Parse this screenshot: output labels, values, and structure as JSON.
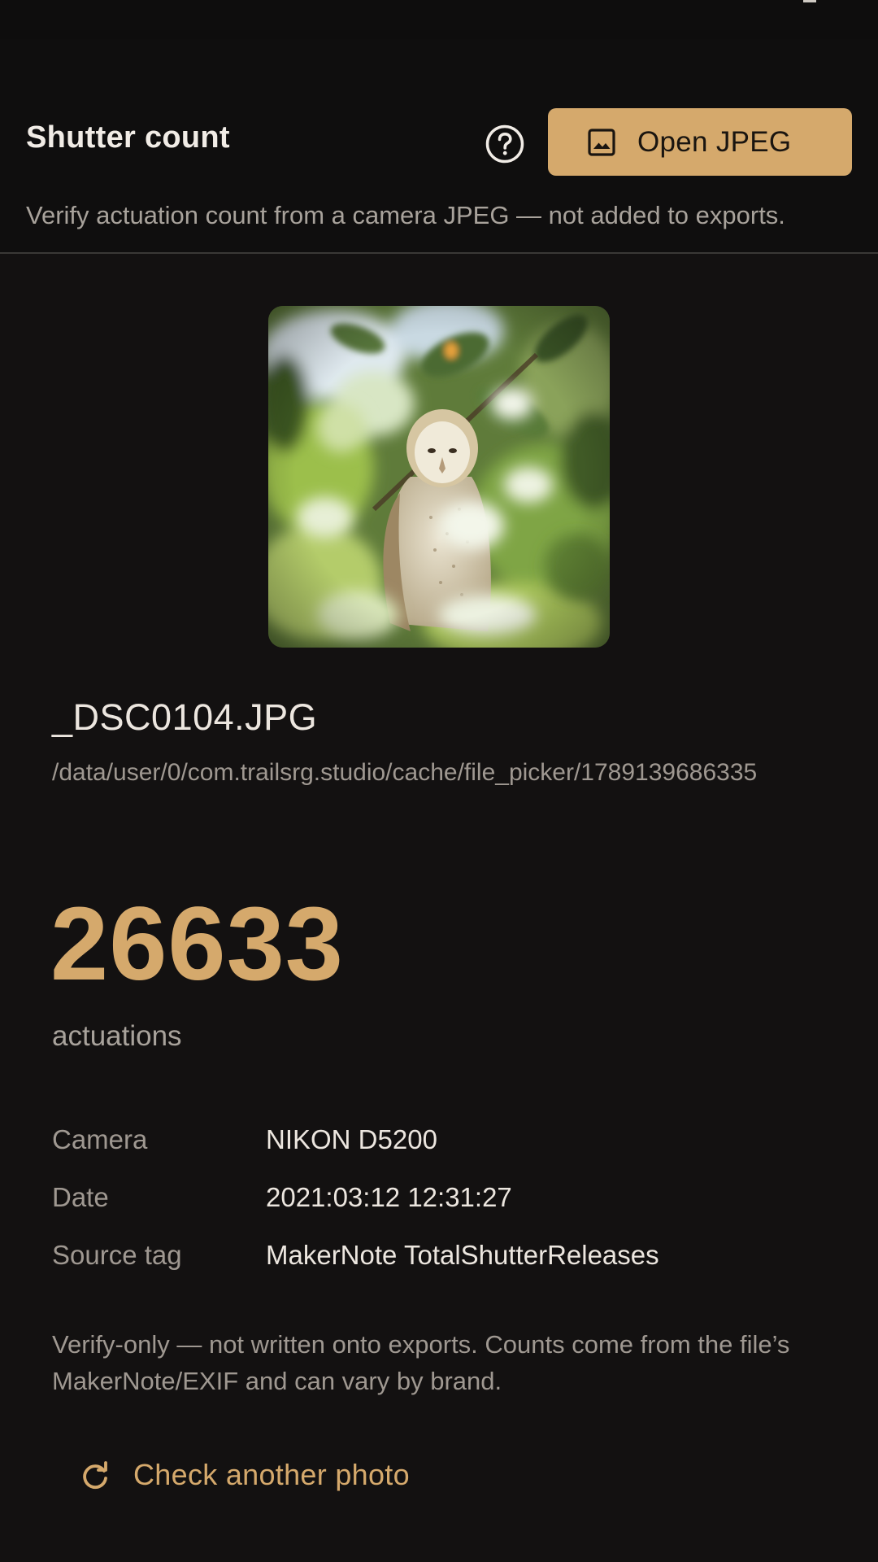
{
  "header": {
    "title": "Shutter count",
    "help_icon": "help-circle-icon",
    "open_button": {
      "label": "Open JPEG",
      "icon": "image-icon"
    },
    "subtitle": "Verify actuation count from a camera JPEG — not added to exports."
  },
  "photo": {
    "file_name": "_DSC0104.JPG",
    "path": "/data/user/0/com.trailsrg.studio/cache/file_picker/1789139686335"
  },
  "result": {
    "count": "26633",
    "unit": "actuations"
  },
  "details": [
    {
      "label": "Camera",
      "value": "NIKON D5200"
    },
    {
      "label": "Date",
      "value": "2021:03:12 12:31:27"
    },
    {
      "label": "Source tag",
      "value": "MakerNote TotalShutterReleases"
    }
  ],
  "note": "Verify-only — not written onto exports. Counts come from the file’s MakerNote/EXIF and can vary by brand.",
  "again_button": {
    "label": "Check another photo",
    "icon": "refresh-icon"
  },
  "colors": {
    "accent": "#d5a96c",
    "background": "#131111",
    "header_background": "#0f0e0e"
  }
}
